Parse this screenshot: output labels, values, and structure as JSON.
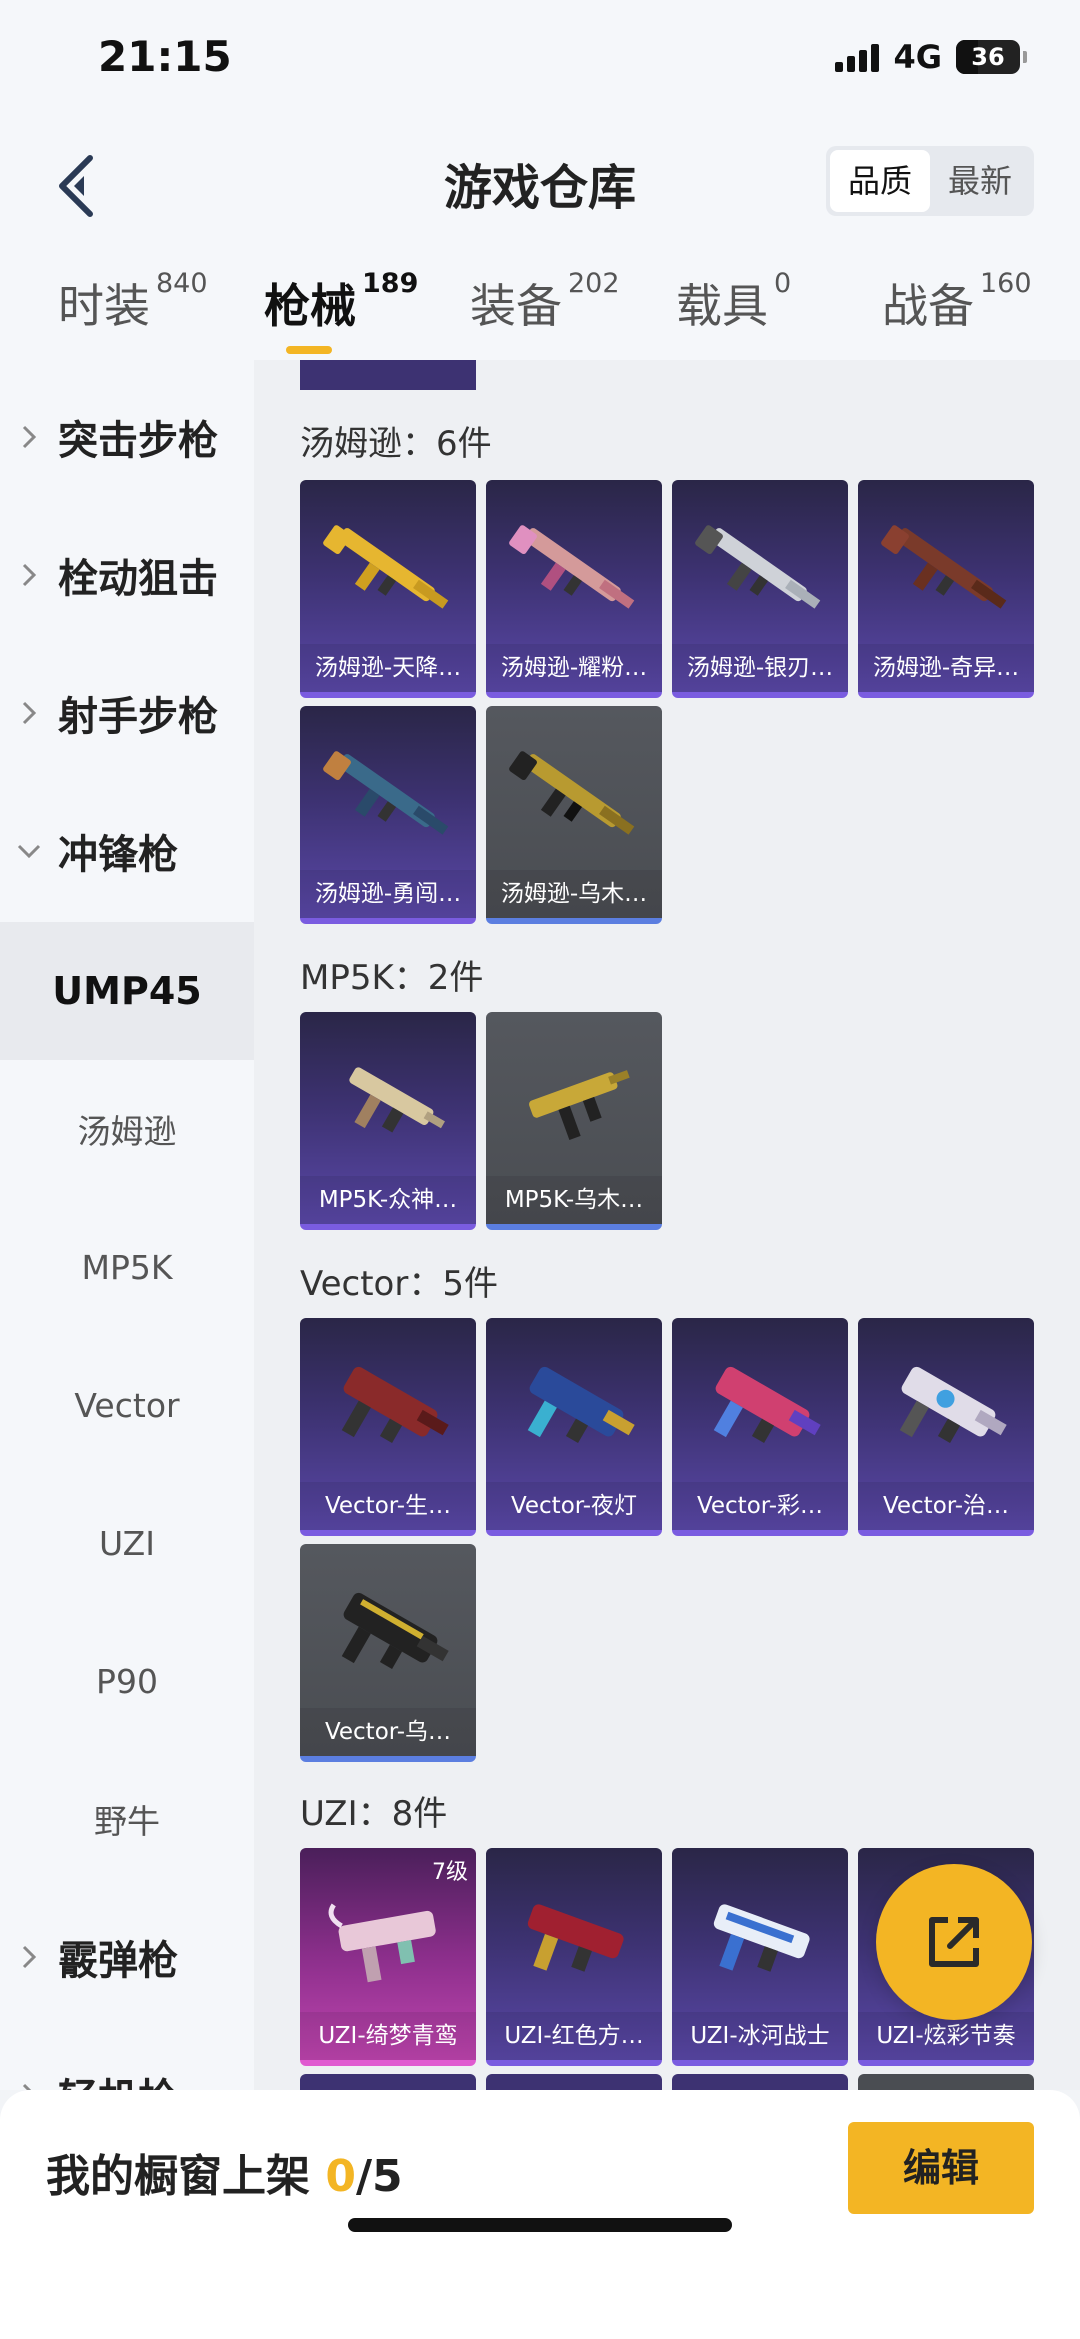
{
  "status": {
    "time": "21:15",
    "network": "4G",
    "battery": "36"
  },
  "header": {
    "title": "游戏仓库",
    "sort_quality": "品质",
    "sort_newest": "最新"
  },
  "tabs": [
    {
      "label": "时装",
      "count": "840"
    },
    {
      "label": "枪械",
      "count": "189"
    },
    {
      "label": "装备",
      "count": "202"
    },
    {
      "label": "载具",
      "count": "0"
    },
    {
      "label": "战备",
      "count": "160"
    }
  ],
  "sidebar": {
    "categories": [
      "突击步枪",
      "栓动狙击",
      "射手步枪",
      "冲锋枪",
      "霰弹枪",
      "轻机枪"
    ],
    "selected": "UMP45",
    "subs": [
      "汤姆逊",
      "MP5K",
      "Vector",
      "UZI",
      "P90",
      "野牛"
    ]
  },
  "sections": [
    {
      "title": "汤姆逊：6件",
      "items": [
        "汤姆逊-天降…",
        "汤姆逊-耀粉…",
        "汤姆逊-银刃…",
        "汤姆逊-奇异…",
        "汤姆逊-勇闯…",
        "汤姆逊-乌木…"
      ]
    },
    {
      "title": "MP5K：2件",
      "items": [
        "MP5K-众神…",
        "MP5K-乌木…"
      ]
    },
    {
      "title": "Vector：5件",
      "items": [
        "Vector-生…",
        "Vector-夜灯",
        "Vector-彩…",
        "Vector-治…",
        "Vector-乌…"
      ]
    },
    {
      "title": "UZI：8件",
      "items": [
        "UZI-绮梦青鸾",
        "UZI-红色方…",
        "UZI-冰河战士",
        "UZI-炫彩节奏"
      ],
      "level": "7级"
    }
  ],
  "bottom": {
    "label": "我的橱窗上架 ",
    "count": "0",
    "total": "/5",
    "edit": "编辑"
  },
  "colors": {
    "accent": "#f3b524",
    "card_purple": "#3d3272",
    "card_gray": "#4a4d52"
  }
}
